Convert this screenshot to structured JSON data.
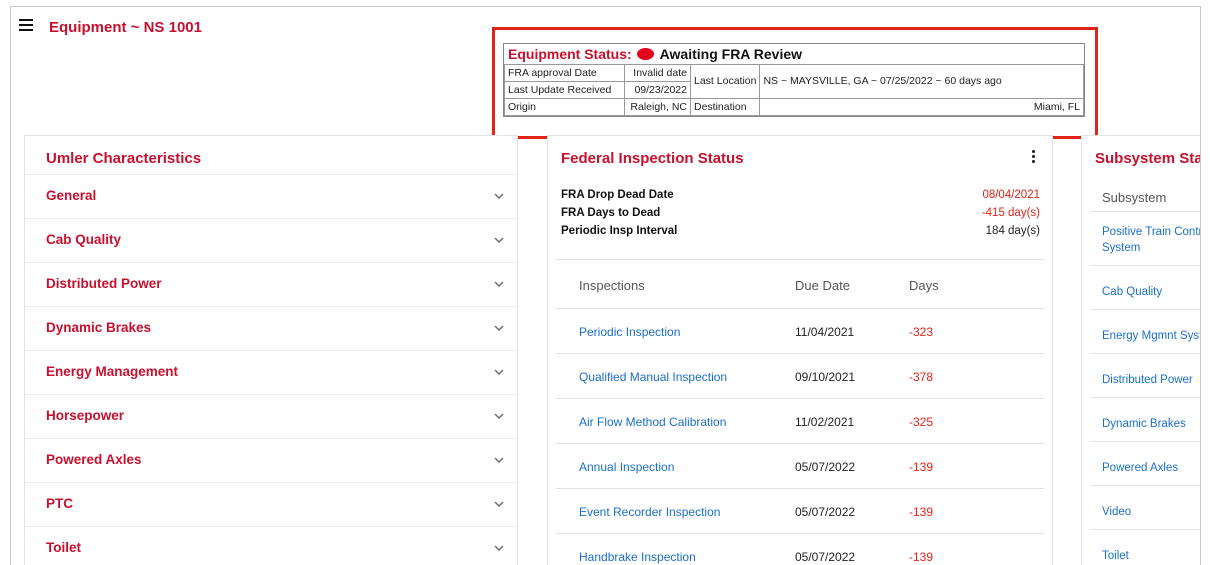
{
  "header": {
    "title": "Equipment ~ NS 1001",
    "menu_icon": "hamburger-menu-icon"
  },
  "equipment_status": {
    "label": "Equipment Status:",
    "indicator_color": "#e2001a",
    "value": "Awaiting FRA Review",
    "fra_approval_date_label": "FRA approval Date",
    "fra_approval_date_value": "Invalid date",
    "last_update_label": "Last Update Received",
    "last_update_value": "09/23/2022",
    "last_location_label": "Last Location",
    "last_location_value": "NS ~ MAYSVILLE, GA ~ 07/25/2022 ~ 60 days ago",
    "origin_label": "Origin",
    "origin_value": "Raleigh, NC",
    "destination_label": "Destination",
    "destination_value": "Miami, FL"
  },
  "umler": {
    "title": "Umler Characteristics",
    "items": [
      "General",
      "Cab Quality",
      "Distributed Power",
      "Dynamic Brakes",
      "Energy Management",
      "Horsepower",
      "Powered Axles",
      "PTC",
      "Toilet"
    ]
  },
  "federal": {
    "title": "Federal Inspection Status",
    "fra_drop_dead_label": "FRA Drop Dead Date",
    "fra_drop_dead_value": "08/04/2021",
    "fra_days_label": "FRA Days to Dead",
    "fra_days_value": "-415 day(s)",
    "periodic_label": "Periodic Insp Interval",
    "periodic_value": "184 day(s)",
    "columns": [
      "Inspections",
      "Due Date",
      "Days"
    ],
    "rows": [
      {
        "name": "Periodic Inspection",
        "due": "11/04/2021",
        "days": "-323"
      },
      {
        "name": "Qualified Manual Inspection",
        "due": "09/10/2021",
        "days": "-378"
      },
      {
        "name": "Air Flow Method Calibration",
        "due": "11/02/2021",
        "days": "-325"
      },
      {
        "name": "Annual Inspection",
        "due": "05/07/2022",
        "days": "-139"
      },
      {
        "name": "Event Recorder Inspection",
        "due": "05/07/2022",
        "days": "-139"
      },
      {
        "name": "Handbrake Inspection",
        "due": "05/07/2022",
        "days": "-139"
      }
    ]
  },
  "subsystem": {
    "title": "Subsystem Stat",
    "column": "Subsystem",
    "rows": [
      {
        "line1": "Positive Train Contro",
        "line2": "System"
      },
      {
        "line1": "Cab Quality"
      },
      {
        "line1": "Energy Mgmnt Syst"
      },
      {
        "line1": "Distributed Power"
      },
      {
        "line1": "Dynamic Brakes"
      },
      {
        "line1": "Powered Axles"
      },
      {
        "line1": "Video"
      },
      {
        "line1": "Toilet"
      }
    ]
  },
  "colors": {
    "brand_red": "#c8102e",
    "alert_red": "#e2231a",
    "link_blue": "#1a6fc9"
  }
}
